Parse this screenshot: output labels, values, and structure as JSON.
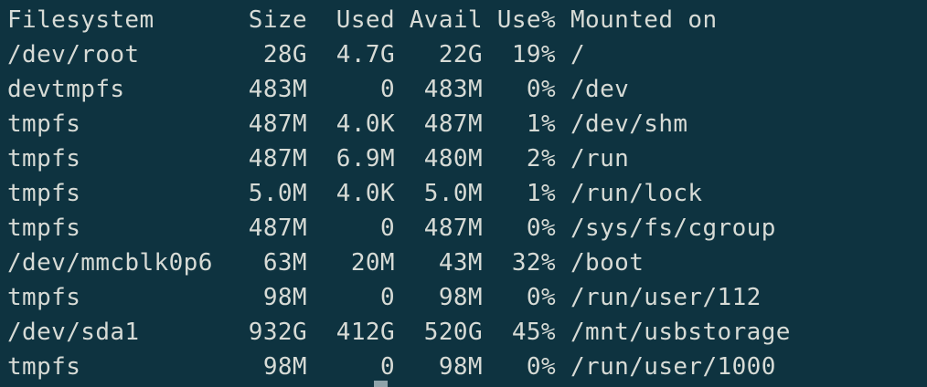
{
  "header": {
    "filesystem": "Filesystem",
    "size": "Size",
    "used": "Used",
    "avail": "Avail",
    "use_pct": "Use%",
    "mounted_on": "Mounted on"
  },
  "rows": [
    {
      "filesystem": "/dev/root",
      "size": "28G",
      "used": "4.7G",
      "avail": "22G",
      "use_pct": "19%",
      "mounted_on": "/"
    },
    {
      "filesystem": "devtmpfs",
      "size": "483M",
      "used": "0",
      "avail": "483M",
      "use_pct": "0%",
      "mounted_on": "/dev"
    },
    {
      "filesystem": "tmpfs",
      "size": "487M",
      "used": "4.0K",
      "avail": "487M",
      "use_pct": "1%",
      "mounted_on": "/dev/shm"
    },
    {
      "filesystem": "tmpfs",
      "size": "487M",
      "used": "6.9M",
      "avail": "480M",
      "use_pct": "2%",
      "mounted_on": "/run"
    },
    {
      "filesystem": "tmpfs",
      "size": "5.0M",
      "used": "4.0K",
      "avail": "5.0M",
      "use_pct": "1%",
      "mounted_on": "/run/lock"
    },
    {
      "filesystem": "tmpfs",
      "size": "487M",
      "used": "0",
      "avail": "487M",
      "use_pct": "0%",
      "mounted_on": "/sys/fs/cgroup"
    },
    {
      "filesystem": "/dev/mmcblk0p6",
      "size": "63M",
      "used": "20M",
      "avail": "43M",
      "use_pct": "32%",
      "mounted_on": "/boot"
    },
    {
      "filesystem": "tmpfs",
      "size": "98M",
      "used": "0",
      "avail": "98M",
      "use_pct": "0%",
      "mounted_on": "/run/user/112"
    },
    {
      "filesystem": "/dev/sda1",
      "size": "932G",
      "used": "412G",
      "avail": "520G",
      "use_pct": "45%",
      "mounted_on": "/mnt/usbstorage"
    },
    {
      "filesystem": "tmpfs",
      "size": "98M",
      "used": "0",
      "avail": "98M",
      "use_pct": "0%",
      "mounted_on": "/run/user/1000"
    }
  ],
  "colors": {
    "background": "#0e3340",
    "text": "#d7dbd6",
    "cursor": "#8fa3aa"
  }
}
